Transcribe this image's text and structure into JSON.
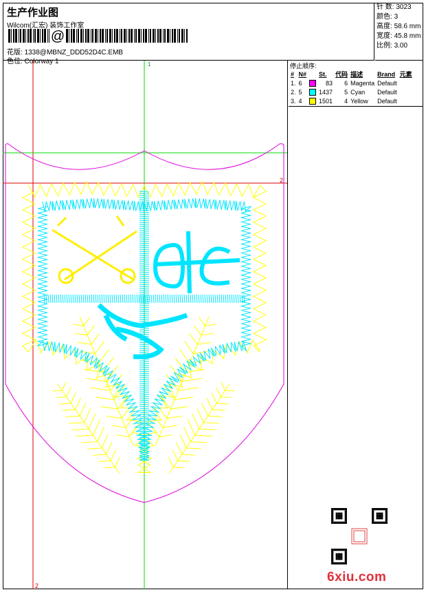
{
  "header": {
    "title": "生产作业图",
    "company": "Wilcom(汇宏) 装饰工作室",
    "barcode_symbol": "@",
    "design_label": "花版:",
    "design_value": "1338@MBNZ_DDD52D4C.EMB",
    "colorway_label": "色位:",
    "colorway_value": "Colorway 1"
  },
  "stats": [
    {
      "label": "针 数:",
      "value": "3023"
    },
    {
      "label": "颜色:",
      "value": "3"
    },
    {
      "label": "高度:",
      "value": "58.6 mm"
    },
    {
      "label": "宽度:",
      "value": "45.8 mm"
    },
    {
      "label": "比例:",
      "value": "3.00"
    }
  ],
  "stop_sequence": {
    "title": "停止顺序:",
    "columns": [
      "#",
      "N#",
      "St.",
      "代码",
      "描述",
      "Brand",
      "元素"
    ],
    "rows": [
      {
        "idx": "1.",
        "n": "6",
        "color": "#ff00ff",
        "st": "83",
        "code": "6",
        "desc": "Magenta",
        "brand": "Default"
      },
      {
        "idx": "2.",
        "n": "5",
        "color": "#00ffff",
        "st": "1437",
        "code": "5",
        "desc": "Cyan",
        "brand": "Default"
      },
      {
        "idx": "3.",
        "n": "4",
        "color": "#ffff00",
        "st": "1501",
        "code": "4",
        "desc": "Yellow",
        "brand": "Default"
      }
    ]
  },
  "canvas": {
    "guide_marker_top": "1",
    "guide_marker_right": "2",
    "guide_marker_bottom": "2",
    "colors": {
      "magenta": "#e000e0",
      "cyan": "#00e5ff",
      "yellow": "#ffff00",
      "green": "#00dd00",
      "red": "#cc0000"
    }
  },
  "watermark": "6xiu.com"
}
